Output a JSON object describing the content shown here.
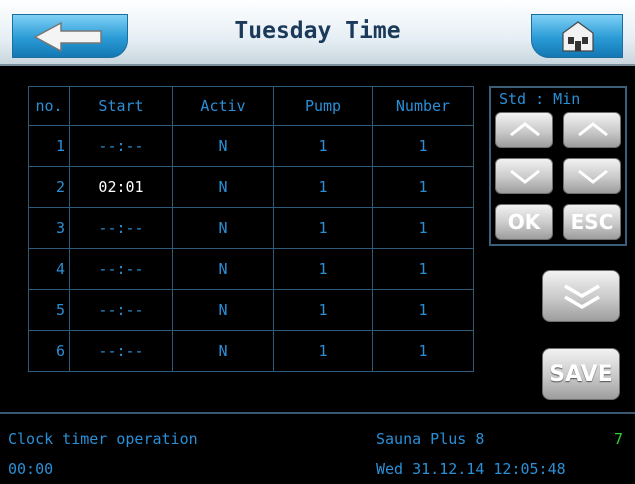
{
  "header": {
    "title": "Tuesday Time"
  },
  "table": {
    "headers": [
      "no.",
      "Start",
      "Activ",
      "Pump",
      "Number"
    ],
    "rows": [
      {
        "no": "1",
        "start": "--:--",
        "activ": "N",
        "pump": "1",
        "number": "1"
      },
      {
        "no": "2",
        "start": "02:01",
        "activ": "N",
        "pump": "1",
        "number": "1"
      },
      {
        "no": "3",
        "start": "--:--",
        "activ": "N",
        "pump": "1",
        "number": "1"
      },
      {
        "no": "4",
        "start": "--:--",
        "activ": "N",
        "pump": "1",
        "number": "1"
      },
      {
        "no": "5",
        "start": "--:--",
        "activ": "N",
        "pump": "1",
        "number": "1"
      },
      {
        "no": "6",
        "start": "--:--",
        "activ": "N",
        "pump": "1",
        "number": "1"
      }
    ]
  },
  "panel": {
    "label": "Std : Min",
    "ok": "OK",
    "esc": "ESC"
  },
  "buttons": {
    "save": "SAVE"
  },
  "footer": {
    "mode": "Clock timer operation",
    "device": "Sauna Plus 8",
    "indicator": "7",
    "time": "00:00",
    "datetime": "Wed 31.12.14 12:05:48"
  },
  "colors": {
    "text_blue": "#2a8fd6",
    "accent_blue": "#2a9bd6",
    "indicator_green": "#2fd02f"
  }
}
